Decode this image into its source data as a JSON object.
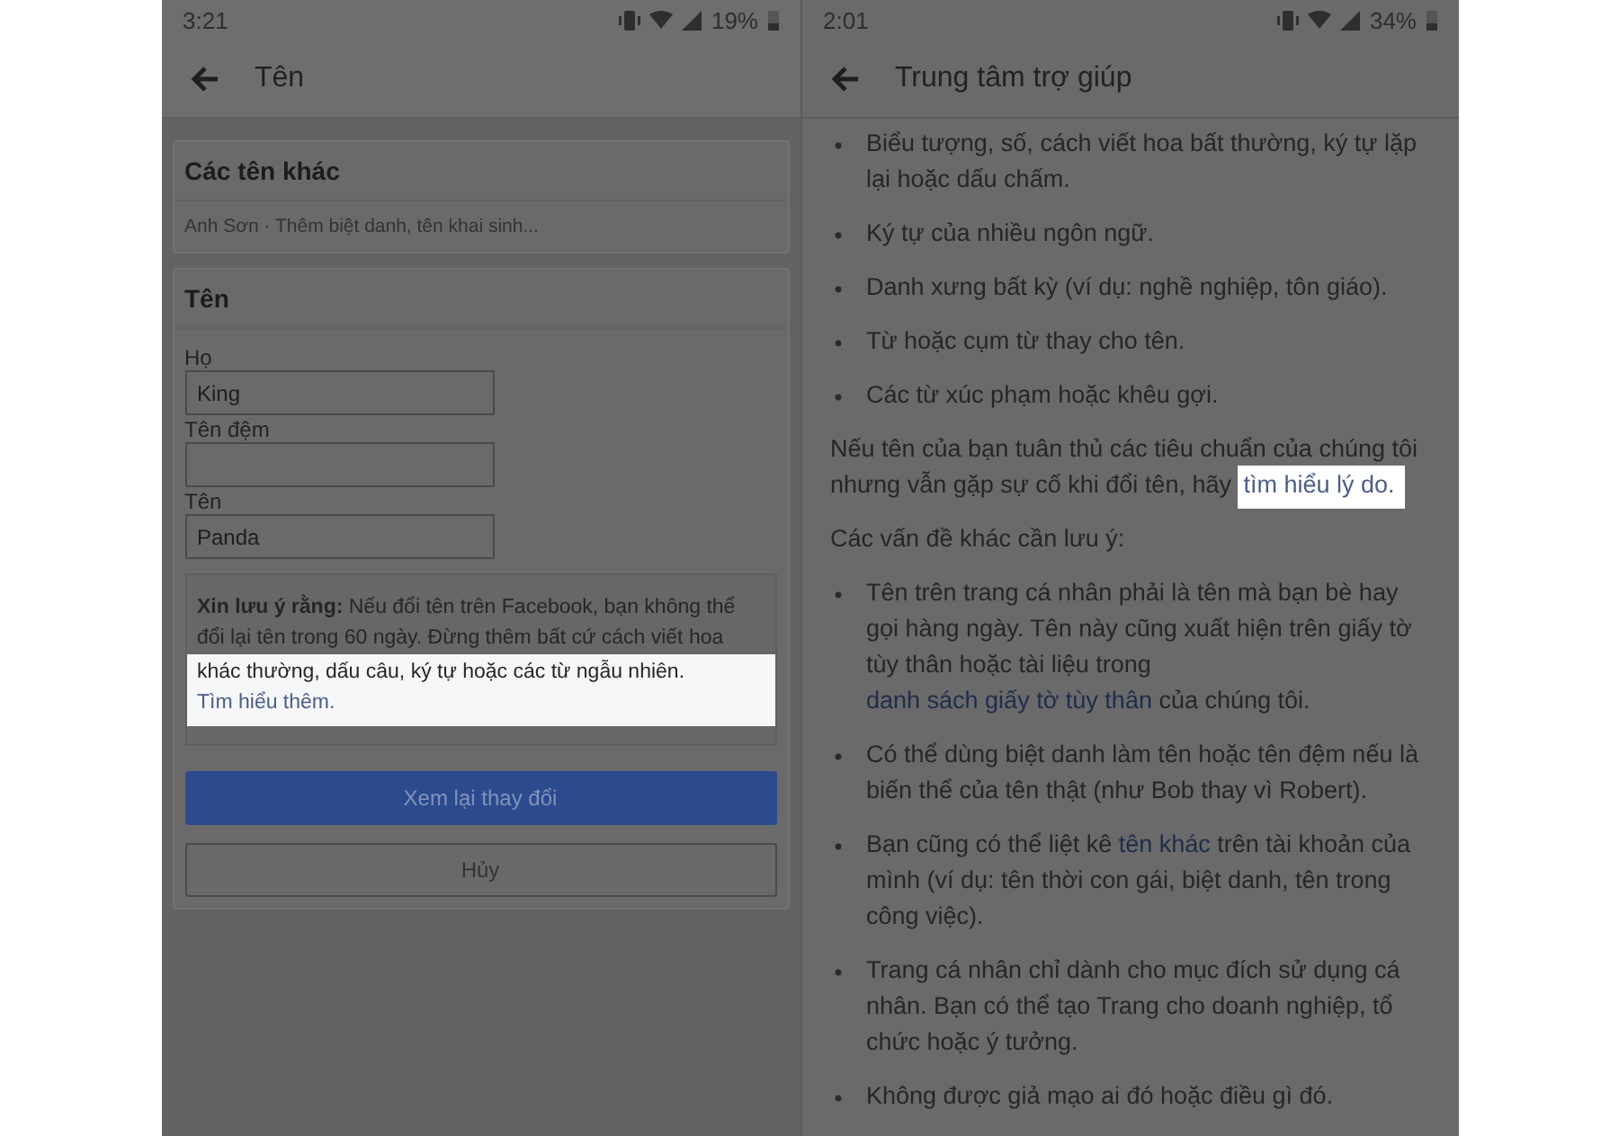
{
  "left_screen": {
    "status_bar": {
      "time": "3:21",
      "battery": "19%"
    },
    "title": "Tên",
    "other_names": {
      "heading": "Các tên khác",
      "summary": "Anh Sơn · Thêm biệt danh, tên khai sinh..."
    },
    "name_section": {
      "heading": "Tên",
      "fields": [
        {
          "label": "Họ",
          "value": "King"
        },
        {
          "label": "Tên đệm"
        },
        {
          "label": "Tên",
          "value": "Panda"
        }
      ],
      "note": [
        {
          "text": "**Xin lưu ý rằng:** Nếu đổi tên trên Facebook, bạn không thể đổi lại tên trong 60 ngày. Đừng thêm bất cứ cách viết hoa",
          "highlighted": false
        },
        {
          "text": "khác thường, dấu câu, ký tự hoặc các từ ngẫu nhiên.",
          "link": "Tìm hiểu thêm.",
          "highlighted": true
        }
      ],
      "buttons": [
        {
          "label": "Xem lại thay đổi",
          "kind": "primary"
        },
        {
          "label": "Hủy",
          "kind": "secondary"
        }
      ]
    }
  },
  "right_screen": {
    "status_bar": {
      "time": "2:01",
      "battery": "34%"
    },
    "title": "Trung tâm trợ giúp",
    "blocks": [
      {
        "kind": "bullets",
        "items": [
          [
            {
              "kind": "text",
              "text": "Biểu tượng, số, cách viết hoa bất thường, ký tự lặp lại hoặc dấu chấm."
            }
          ],
          [
            {
              "kind": "text",
              "text": "Ký tự của nhiều ngôn ngữ."
            }
          ],
          [
            {
              "kind": "text",
              "text": "Danh xưng bất kỳ (ví dụ: nghề nghiệp, tôn giáo)."
            }
          ],
          [
            {
              "kind": "text",
              "text": "Từ hoặc cụm từ thay cho tên."
            }
          ],
          [
            {
              "kind": "text",
              "text": "Các từ xúc phạm hoặc khêu gợi."
            }
          ]
        ]
      },
      {
        "kind": "paragraph",
        "parts": [
          {
            "kind": "text",
            "text": "Nếu tên của bạn tuân thủ các tiêu chuẩn của chúng tôi nhưng vẫn gặp sự cố khi đổi tên, hãy"
          },
          {
            "kind": "link",
            "text": "tìm hiểu lý do.",
            "highlighted": true
          }
        ]
      },
      {
        "kind": "paragraph",
        "parts": [
          {
            "kind": "text",
            "text": "Các vấn đề khác cần lưu ý:"
          }
        ]
      },
      {
        "kind": "bullets",
        "items": [
          [
            {
              "kind": "text",
              "text": "Tên trên trang cá nhân phải là tên mà bạn bè hay gọi hàng ngày. Tên này cũng xuất hiện trên giấy tờ tùy thân hoặc tài liệu trong"
            },
            {
              "kind": "link",
              "text": "danh sách giấy tờ tùy thân",
              "highlighted": false
            },
            {
              "kind": "text",
              "text": "của chúng tôi."
            }
          ],
          [
            {
              "kind": "text",
              "text": "Có thể dùng biệt danh làm tên hoặc tên đệm nếu là biến thể của tên thật (như Bob thay vì Robert)."
            }
          ],
          [
            {
              "kind": "text",
              "text": "Bạn cũng có thể liệt kê"
            },
            {
              "kind": "link",
              "text": "tên khác",
              "highlighted": false
            },
            {
              "kind": "text",
              "text": "trên tài khoản của mình (ví dụ: tên thời con gái, biệt danh, tên trong công việc)."
            }
          ],
          [
            {
              "kind": "text",
              "text": "Trang cá nhân chỉ dành cho mục đích sử dụng cá nhân. Bạn có thể tạo Trang cho doanh nghiệp, tổ chức hoặc ý tưởng."
            }
          ],
          [
            {
              "kind": "text",
              "text": "Không được giả mạo ai đó hoặc điều gì đó."
            }
          ]
        ]
      }
    ]
  }
}
